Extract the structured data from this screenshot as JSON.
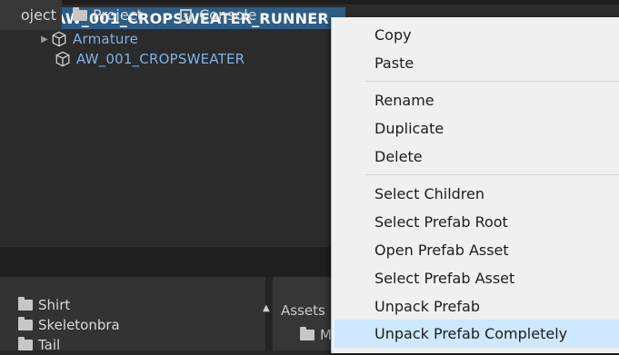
{
  "hierarchy": {
    "root_label": "AW_001_CROPSWEATER_RUNNER",
    "armature_label": "Armature",
    "mesh_label": "AW_001_CROPSWEATER"
  },
  "tabs": {
    "project_active": "oject",
    "project": "Project",
    "console": "Console"
  },
  "project_tree": {
    "items": [
      "Shirt",
      "Skeletonbra",
      "Tail"
    ]
  },
  "project_right": {
    "breadcrumb": "Assets",
    "item": "M"
  },
  "context_menu": {
    "items": [
      "Copy",
      "Paste",
      "Rename",
      "Duplicate",
      "Delete",
      "Select Children",
      "Select Prefab Root",
      "Open Prefab Asset",
      "Select Prefab Asset",
      "Unpack Prefab",
      "Unpack Prefab Completely"
    ],
    "highlighted": "Unpack Prefab Completely"
  },
  "colors": {
    "selection": "#2c5d87",
    "child_text": "#7fb2e8",
    "menu_bg": "#f0f0f0",
    "menu_highlight": "#cde8ff"
  },
  "icons": {
    "expand_arrow": "triangle-down-icon",
    "collapse_arrow": "triangle-right-icon",
    "prefab": "prefab-cube-icon",
    "folder": "folder-icon",
    "console": "console-icon"
  }
}
